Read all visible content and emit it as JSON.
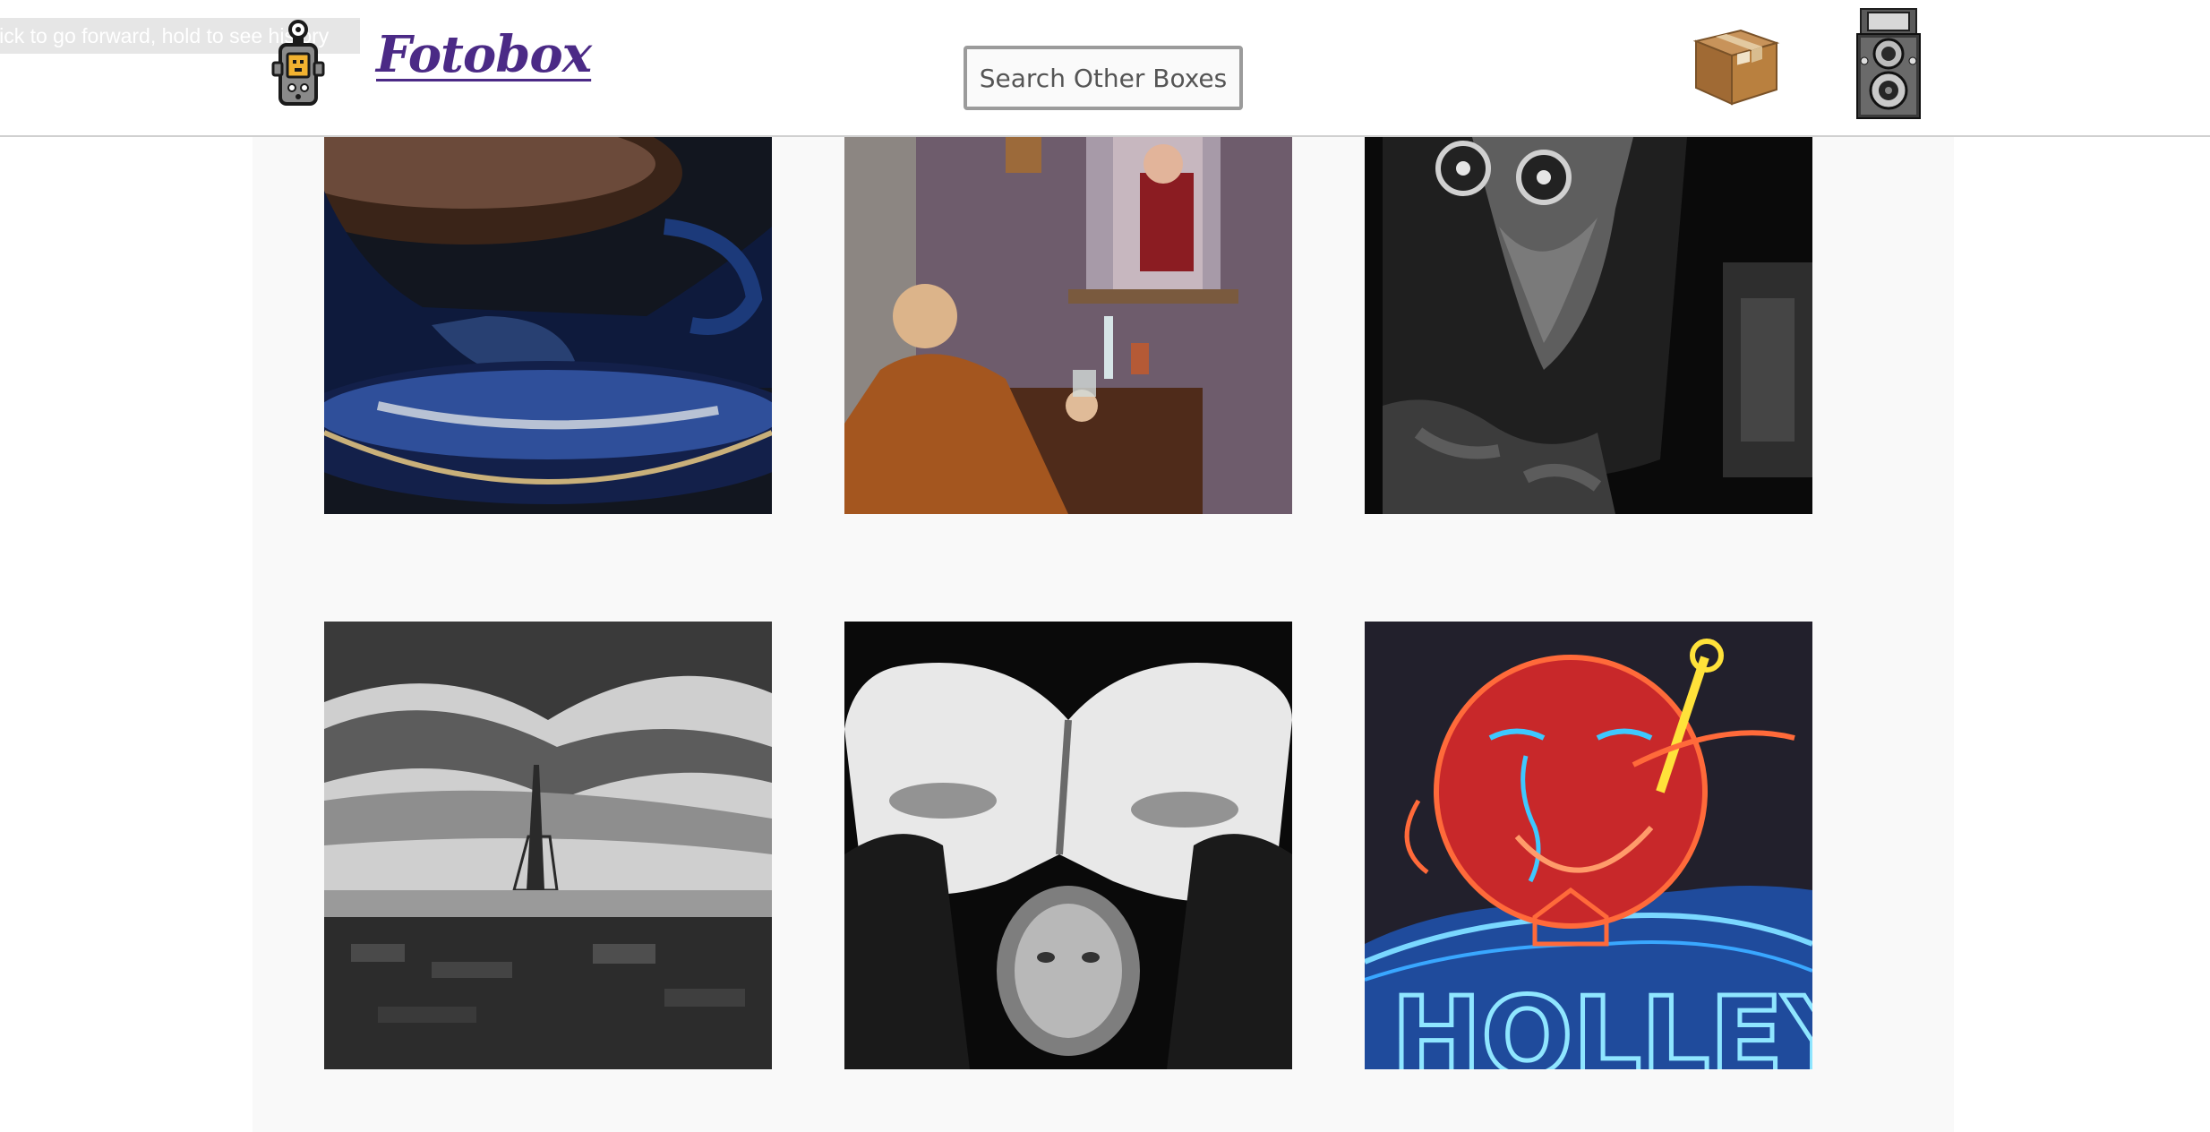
{
  "header": {
    "tooltip": "lick to go forward, hold to see history",
    "brand": "Fotobox",
    "search_placeholder": "Search Other Boxes"
  },
  "icons": {
    "logo": "light-meter-icon",
    "boxes": "cardboard-box-icon",
    "camera": "twin-lens-camera-icon"
  },
  "photos": [
    {
      "name": "photo-coffee-cup",
      "subject": "coffee-cup"
    },
    {
      "name": "photo-western-film-still",
      "subject": "western-film-still"
    },
    {
      "name": "photo-hooded-figure-goggles",
      "subject": "hooded-figure"
    },
    {
      "name": "photo-eiffel-tower-bw",
      "subject": "eiffel-tower"
    },
    {
      "name": "photo-mask-face-bw",
      "subject": "mask-face"
    },
    {
      "name": "photo-neon-sign",
      "subject": "neon-sign"
    }
  ],
  "colors": {
    "brand": "#4b2a86",
    "gallery_bg": "#f9f9f9",
    "header_border": "#d0d0d0"
  }
}
